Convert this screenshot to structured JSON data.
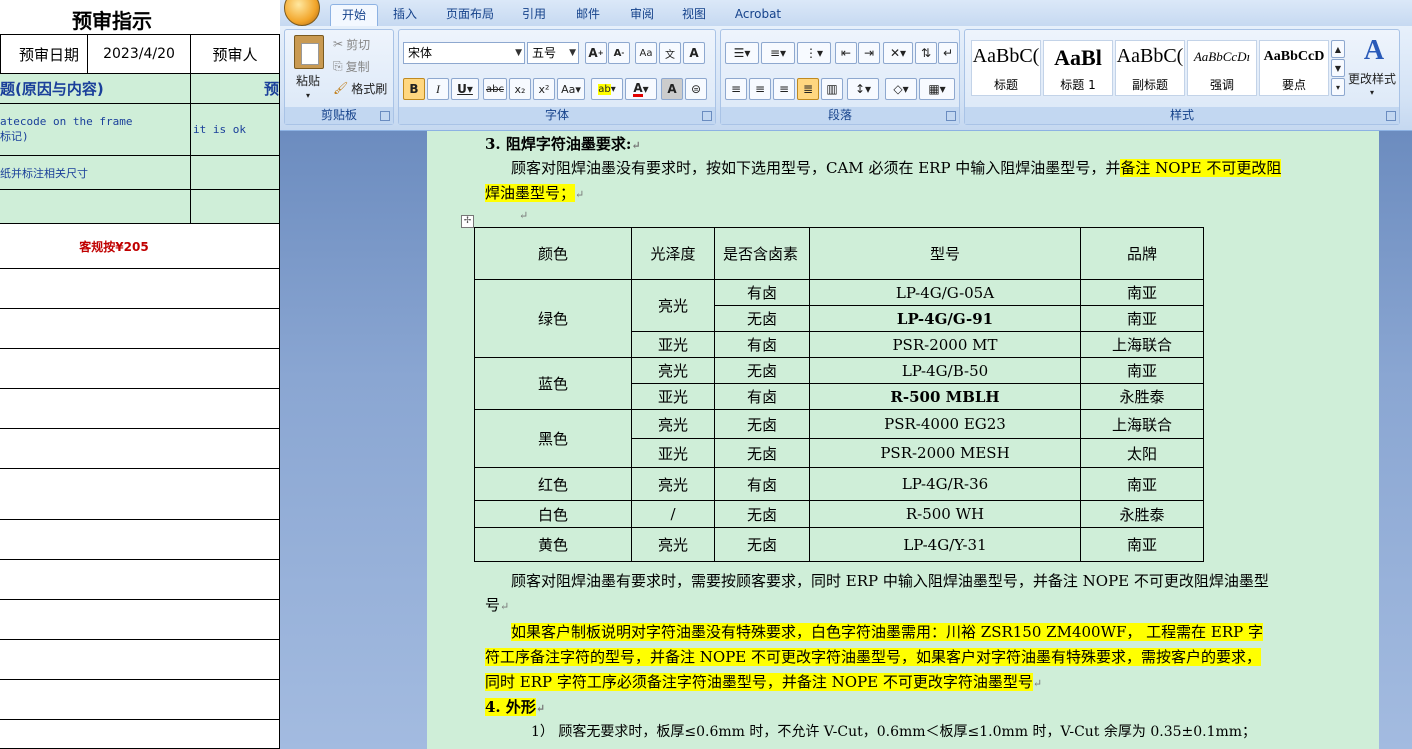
{
  "sheet": {
    "title": "预审指示",
    "header": {
      "date_label": "预审日期",
      "date_value": "2023/4/20",
      "reviewer_label": "预审人"
    },
    "issue_header": "题(原因与内容)",
    "issue_header_right": "预",
    "row1_left": [
      "atecode on the frame",
      "标记)"
    ],
    "row1_right": "it is ok",
    "row2_left": "纸并标注相关尺寸",
    "price_note": "客规按¥205"
  },
  "word": {
    "tabs": [
      "开始",
      "插入",
      "页面布局",
      "引用",
      "邮件",
      "审阅",
      "视图",
      "Acrobat"
    ],
    "active_tab": "开始",
    "clipboard": {
      "paste": "粘贴",
      "cut": "剪切",
      "copy": "复制",
      "format_painter": "格式刷",
      "label": "剪贴板"
    },
    "font": {
      "name": "宋体",
      "size": "五号",
      "label": "字体"
    },
    "paragraph_label": "段落",
    "styles": {
      "label": "样式",
      "change": "更改样式",
      "items": [
        {
          "preview": "AaBbC(",
          "name": "标题"
        },
        {
          "preview": "AaBl",
          "name": "标题 1"
        },
        {
          "preview": "AaBbC(",
          "name": "副标题"
        },
        {
          "preview": "AaBbCcDı",
          "name": "强调"
        },
        {
          "preview": "AaBbCcD",
          "name": "要点"
        }
      ]
    },
    "doc": {
      "heading3": "3. 阻焊字符油墨要求:",
      "intro_plain": "顾客对阻焊油墨没有要求时，按如下选用型号，CAM 必须在 ERP 中输入阻焊油墨型号，并",
      "intro_hl1": "备注 NOPE 不可更改阻",
      "intro_hl2": "焊油墨型号；",
      "table": {
        "headers": [
          "颜色",
          "光泽度",
          "是否含卤素",
          "型号",
          "品牌"
        ],
        "rows": [
          [
            "绿色",
            "亮光",
            "有卤",
            "LP-4G/G-05A",
            "南亚"
          ],
          [
            "",
            "",
            "无卤",
            "LP-4G/G-91",
            "南亚"
          ],
          [
            "",
            "亚光",
            "有卤",
            "PSR-2000 MT",
            "上海联合"
          ],
          [
            "蓝色",
            "亮光",
            "无卤",
            "LP-4G/B-50",
            "南亚"
          ],
          [
            "",
            "亚光",
            "有卤",
            "R-500 MBLH",
            "永胜泰"
          ],
          [
            "黑色",
            "亮光",
            "无卤",
            "PSR-4000 EG23",
            "上海联合"
          ],
          [
            "",
            "亚光",
            "无卤",
            "PSR-2000 MESH",
            "太阳"
          ],
          [
            "红色",
            "亮光",
            "有卤",
            "LP-4G/R-36",
            "南亚"
          ],
          [
            "白色",
            "/",
            "无卤",
            "R-500 WH",
            "永胜泰"
          ],
          [
            "黄色",
            "亮光",
            "无卤",
            "LP-4G/Y-31",
            "南亚"
          ]
        ]
      },
      "para2_l1": "顾客对阻焊油墨有要求时，需要按顾客要求，同时 ERP 中输入阻焊油墨型号，并备注 NOPE 不可更改阻焊油墨型",
      "para2_l2": "号",
      "para3_l1": "如果客户制板说明对字符油墨没有特殊要求，白色字符油墨需用：川裕 ZSR150 ZM400WF，  工程需在 ERP 字",
      "para3_l2": "符工序备注字符的型号，并备注 NOPE 不可更改字符油墨型号，如果客户对字符油墨有特殊要求，需按客户的要求，",
      "para3_l3": "同时 ERP 字符工序必须备注字符油墨型号，并备注 NOPE 不可更改字符油墨型号",
      "heading4": "4. 外形",
      "item1": "1） 顾客无要求时，板厚≤0.6mm 时，不允许 V-Cut，0.6mm＜板厚≤1.0mm 时，V-Cut 余厚为 0.35±0.1mm；"
    }
  }
}
